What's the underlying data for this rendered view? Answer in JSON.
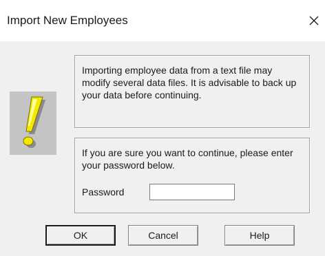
{
  "window": {
    "title": "Import New Employees",
    "close_glyph": "×"
  },
  "icon": {
    "name": "exclamation-warning-icon",
    "color": "#f5e800"
  },
  "warning_panel": {
    "text": "Importing employee data from a text file may modify several data files. It is advisable to back up your data before continuing."
  },
  "confirm_panel": {
    "text": "If you are sure you want to continue, please enter your password below.",
    "password_label": "Password",
    "password_value": "",
    "password_placeholder": ""
  },
  "buttons": {
    "ok": "OK",
    "cancel": "Cancel",
    "help": "Help"
  }
}
